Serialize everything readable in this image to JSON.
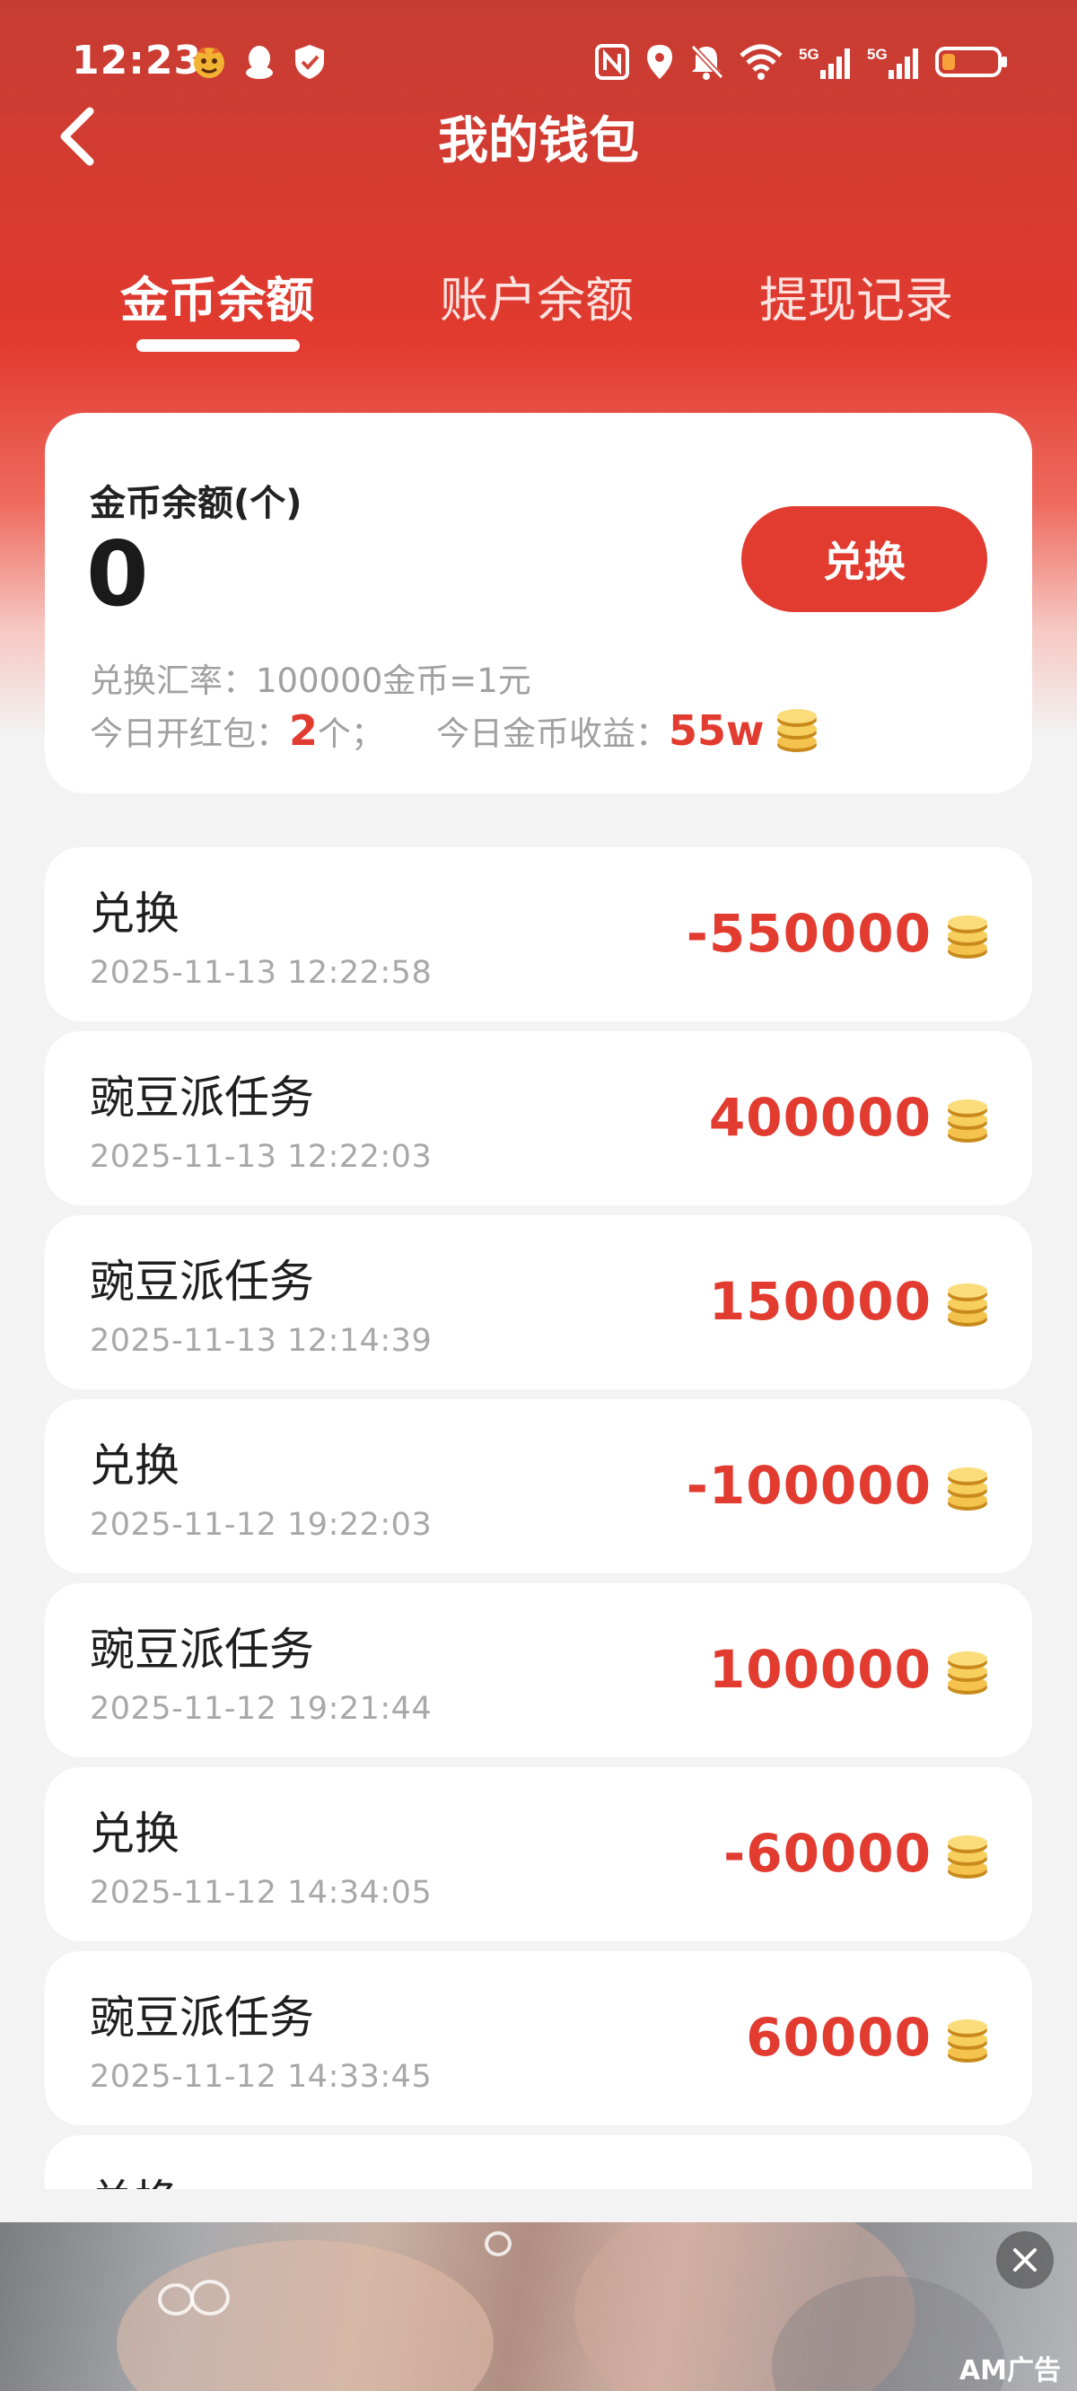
{
  "status_bar": {
    "time": "12:23",
    "network_label_1": "5G",
    "network_label_2": "5G"
  },
  "header": {
    "title": "我的钱包"
  },
  "tabs": [
    {
      "label": "金币余额",
      "active": true
    },
    {
      "label": "账户余额",
      "active": false
    },
    {
      "label": "提现记录",
      "active": false
    }
  ],
  "summary": {
    "label": "金币余额(个)",
    "value": "0",
    "exchange_button": "兑换",
    "rate_label": "兑换汇率：",
    "rate_value": "100000金币=1元",
    "today_packets_label": "今日开红包：",
    "today_packets_value": "2",
    "today_packets_unit": "个；",
    "today_income_label": "今日金币收益：",
    "today_income_value": "55w"
  },
  "records": [
    {
      "title": "兑换",
      "time": "2025-11-13 12:22:58",
      "amount": "-550000"
    },
    {
      "title": "豌豆派任务",
      "time": "2025-11-13 12:22:03",
      "amount": "400000"
    },
    {
      "title": "豌豆派任务",
      "time": "2025-11-13 12:14:39",
      "amount": "150000"
    },
    {
      "title": "兑换",
      "time": "2025-11-12 19:22:03",
      "amount": "-100000"
    },
    {
      "title": "豌豆派任务",
      "time": "2025-11-12 19:21:44",
      "amount": "100000"
    },
    {
      "title": "兑换",
      "time": "2025-11-12 14:34:05",
      "amount": "-60000"
    },
    {
      "title": "豌豆派任务",
      "time": "2025-11-12 14:33:45",
      "amount": "60000"
    },
    {
      "title": "兑换"
    }
  ],
  "ad": {
    "label": "AM广告"
  },
  "colors": {
    "accent_red": "#e23b30",
    "header_red": "#c63c33",
    "page_bg": "#f3f3f3"
  }
}
